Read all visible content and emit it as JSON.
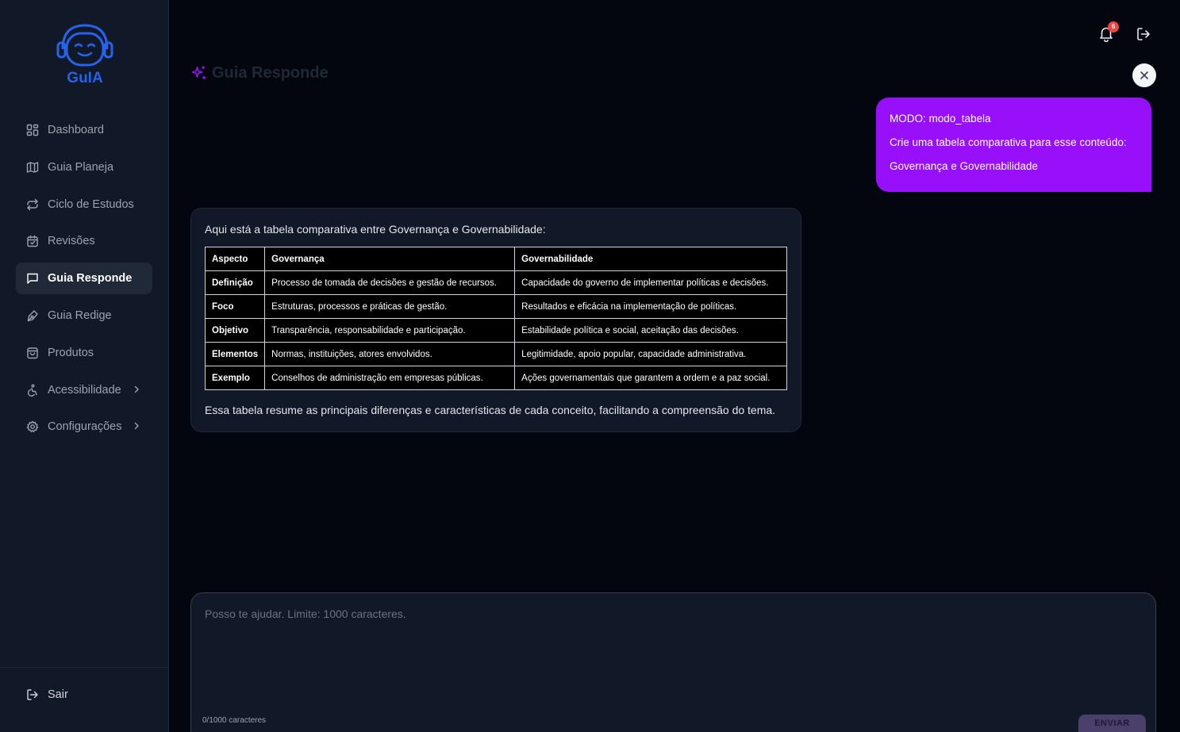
{
  "app": {
    "logo_text": "GuIA",
    "page_title": "Guia Responde"
  },
  "notifications": {
    "count": "6"
  },
  "sidebar": {
    "items": [
      {
        "label": "Dashboard",
        "icon": "dashboard-icon"
      },
      {
        "label": "Guia Planeja",
        "icon": "map-icon"
      },
      {
        "label": "Ciclo de Estudos",
        "icon": "cycle-icon"
      },
      {
        "label": "Revisões",
        "icon": "calendar-icon"
      },
      {
        "label": "Guia Responde",
        "icon": "chat-icon",
        "active": true
      },
      {
        "label": "Guia Redige",
        "icon": "pen-icon"
      },
      {
        "label": "Produtos",
        "icon": "bag-icon"
      },
      {
        "label": "Acessibilidade",
        "icon": "accessibility-icon",
        "has_submenu": true
      },
      {
        "label": "Configurações",
        "icon": "gear-icon",
        "has_submenu": true
      }
    ],
    "logout": "Sair"
  },
  "chat": {
    "user_message": {
      "line1": "MODO: modo_tabela",
      "line2": "Crie uma tabela comparativa para esse conteúdo:",
      "line3": "Governança e Governabilidade"
    },
    "bot_message": {
      "intro": "Aqui está a tabela comparativa entre Governança e Governabilidade:",
      "table": {
        "headers": [
          "Aspecto",
          "Governança",
          "Governabilidade"
        ],
        "rows": [
          [
            "Definição",
            "Processo de tomada de decisões e gestão de recursos.",
            "Capacidade do governo de implementar políticas e decisões."
          ],
          [
            "Foco",
            "Estruturas, processos e práticas de gestão.",
            "Resultados e eficácia na implementação de políticas."
          ],
          [
            "Objetivo",
            "Transparência, responsabilidade e participação.",
            "Estabilidade política e social, aceitação das decisões."
          ],
          [
            "Elementos",
            "Normas, instituições, atores envolvidos.",
            "Legitimidade, apoio popular, capacidade administrativa."
          ],
          [
            "Exemplo",
            "Conselhos de administração em empresas públicas.",
            "Ações governamentais que garantem a ordem e a paz social."
          ]
        ]
      },
      "outro": "Essa tabela resume as principais diferenças e características de cada conceito, facilitando a compreensão do tema."
    }
  },
  "composer": {
    "placeholder": "Posso te ajudar. Limite: 1000 caracteres.",
    "counter": "0/1000 caracteres",
    "send_label": "ENVIAR"
  },
  "colors": {
    "accent": "#9810fa",
    "brand": "#2563eb",
    "badge": "#ef4444"
  }
}
